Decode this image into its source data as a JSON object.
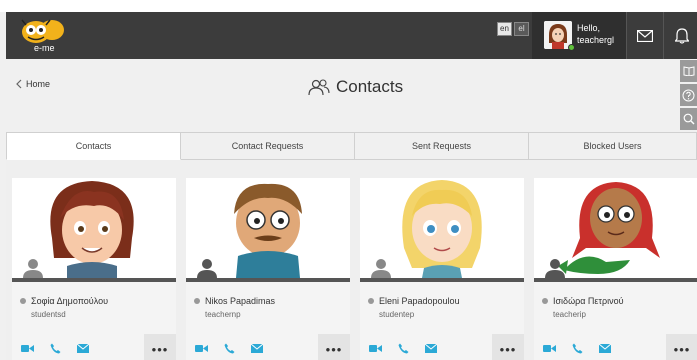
{
  "header": {
    "logo_text": "e-me",
    "languages": [
      "en",
      "el"
    ],
    "active_language": "en",
    "greeting": "Hello,",
    "username": "teachergl"
  },
  "page": {
    "home_label": "Home",
    "title": "Contacts"
  },
  "tabs": [
    {
      "label": "Contacts",
      "active": true
    },
    {
      "label": "Contact Requests",
      "active": false
    },
    {
      "label": "Sent Requests",
      "active": false
    },
    {
      "label": "Blocked Users",
      "active": false
    }
  ],
  "contacts": [
    {
      "name": "Σοφία Δημοπούλου",
      "username": "studentsd"
    },
    {
      "name": "Nikos Papadimas",
      "username": "teachernp"
    },
    {
      "name": "Eleni Papadopoulou",
      "username": "studentep"
    },
    {
      "name": "Ισιδώρα Πετρινού",
      "username": "teacherip"
    }
  ],
  "more_label": "•••",
  "colors": {
    "header_bg": "#3c3c3c",
    "online": "#5fc13a",
    "action_icon": "#2ba9d6"
  }
}
